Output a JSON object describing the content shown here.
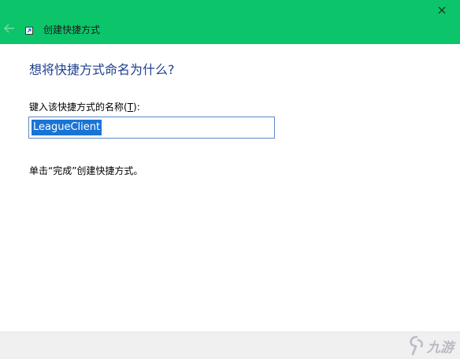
{
  "window": {
    "title": "创建快捷方式",
    "accent_color": "#0cc46a"
  },
  "icons": {
    "back": "arrow-left-icon",
    "wizard": "shortcut-icon",
    "close": "close-icon"
  },
  "main": {
    "heading": "想将快捷方式命名为什么?",
    "label_prefix": "键入该快捷方式的名称(",
    "label_hotkey": "T",
    "label_suffix": "):",
    "input_value": "LeagueClient",
    "hint": "单击“完成”创建快捷方式。"
  },
  "watermark": {
    "text": "九游"
  }
}
